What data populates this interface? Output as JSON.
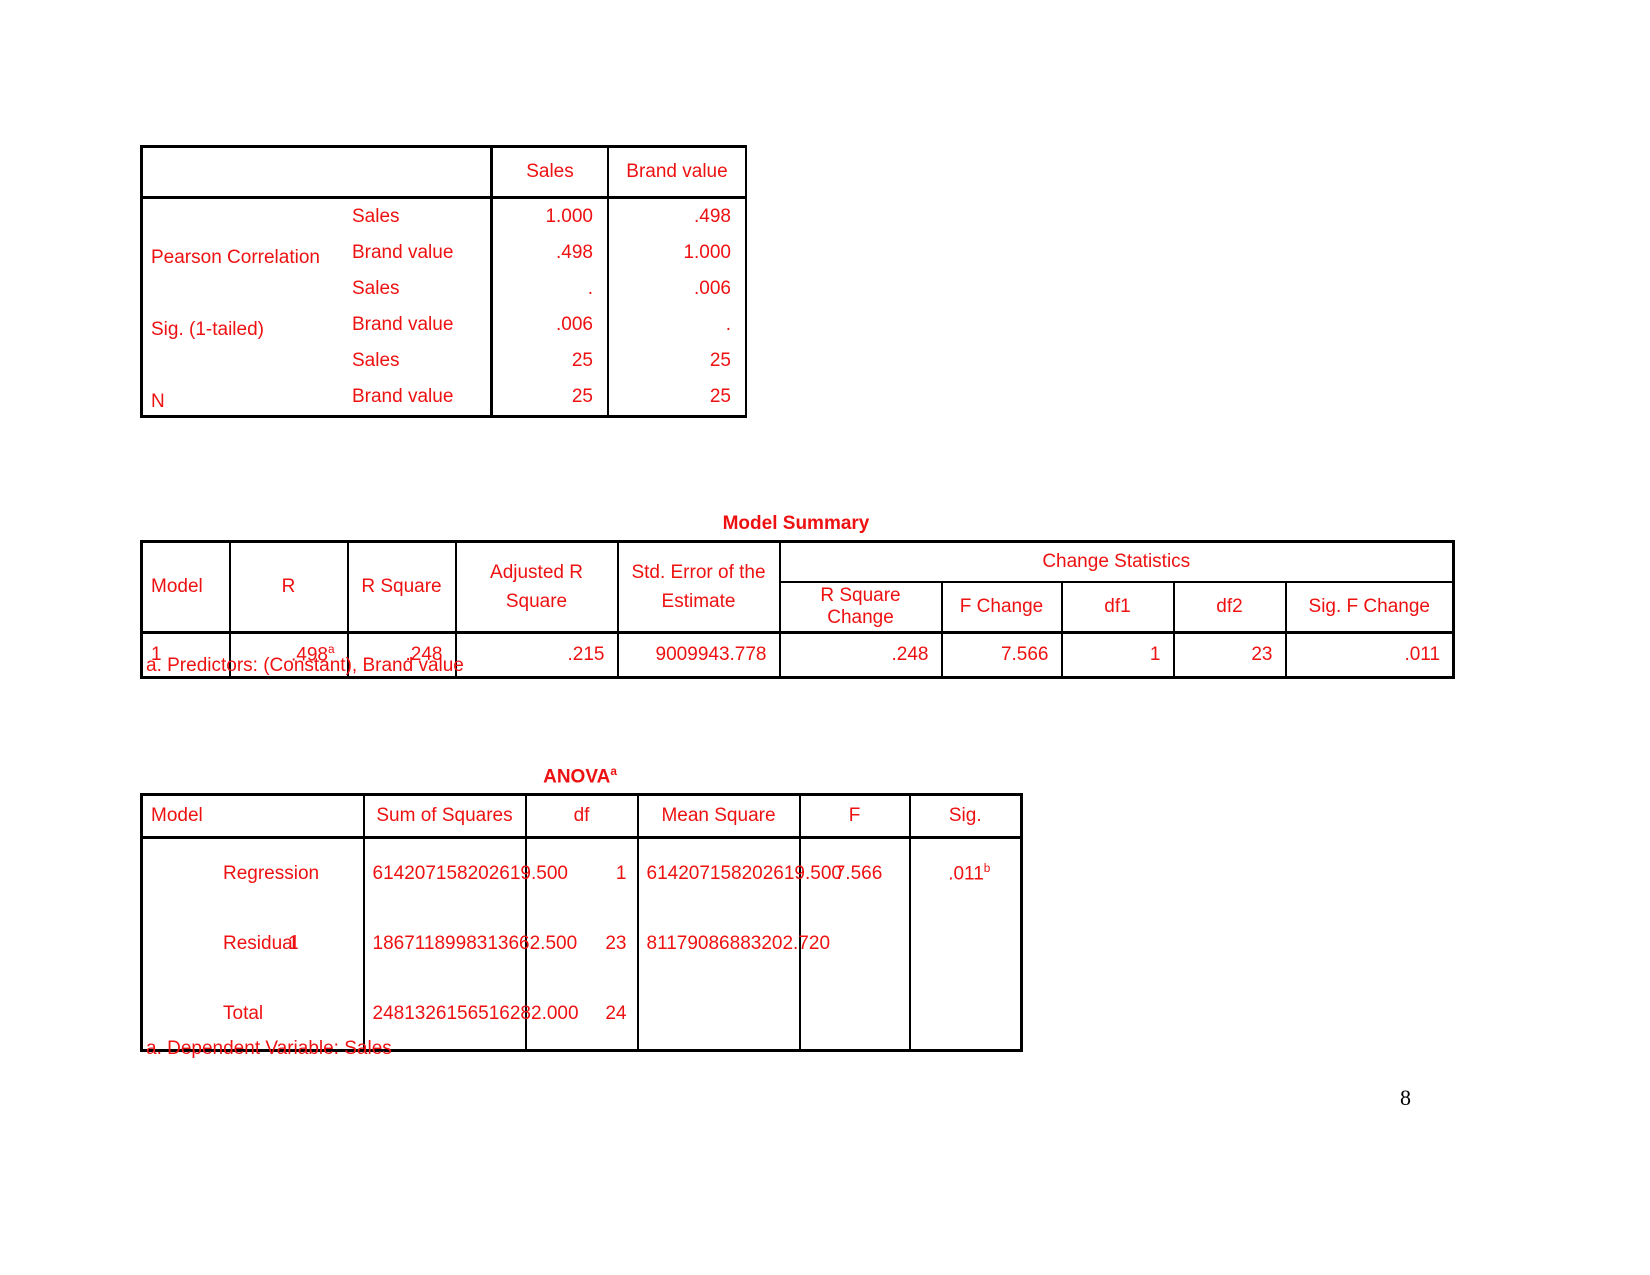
{
  "correlations": {
    "column_headers": [
      "",
      "",
      "Sales",
      "Brand value"
    ],
    "rows": [
      {
        "stat": "Pearson Correlation",
        "variable": "Sales",
        "sales": "1.000",
        "brand_value": ".498"
      },
      {
        "stat": "",
        "variable": "Brand value",
        "sales": ".498",
        "brand_value": "1.000"
      },
      {
        "stat": "Sig. (1-tailed)",
        "variable": "Sales",
        "sales": ".",
        "brand_value": ".006"
      },
      {
        "stat": "",
        "variable": "Brand value",
        "sales": ".006",
        "brand_value": "."
      },
      {
        "stat": "N",
        "variable": "Sales",
        "sales": "25",
        "brand_value": "25"
      },
      {
        "stat": "",
        "variable": "Brand value",
        "sales": "25",
        "brand_value": "25"
      }
    ]
  },
  "model_summary": {
    "title": "Model Summary",
    "headers": {
      "model": "Model",
      "r": "R",
      "r_square": "R Square",
      "adjusted_r_square": "Adjusted R Square",
      "std_error": "Std. Error of the Estimate",
      "change_statistics": "Change Statistics",
      "r_square_change": "R Square Change",
      "f_change": "F Change",
      "df1": "df1",
      "df2": "df2",
      "sig_f_change": "Sig. F Change"
    },
    "row": {
      "model": "1",
      "r": ".498",
      "r_superscript": "a",
      "r_square": ".248",
      "adjusted_r_square": ".215",
      "std_error": "9009943.778",
      "r_square_change": ".248",
      "f_change": "7.566",
      "df1": "1",
      "df2": "23",
      "sig_f_change": ".011"
    },
    "footnote": "a. Predictors: (Constant), Brand value"
  },
  "anova": {
    "title": "ANOVA",
    "title_superscript": "a",
    "headers": {
      "model": "Model",
      "sum_of_squares": "Sum of Squares",
      "df": "df",
      "mean_square": "Mean Square",
      "f": "F",
      "sig": "Sig."
    },
    "model_number": "1",
    "rows": [
      {
        "source": "Regression",
        "sum_of_squares": "614207158202619.500",
        "df": "1",
        "mean_square": "614207158202619.500",
        "f": "7.566",
        "sig": ".011",
        "sig_superscript": "b"
      },
      {
        "source": "Residual",
        "sum_of_squares": "1867118998313662.500",
        "df": "23",
        "mean_square": "81179086883202.720",
        "f": "",
        "sig": "",
        "sig_superscript": ""
      },
      {
        "source": "Total",
        "sum_of_squares": "2481326156516282.000",
        "df": "24",
        "mean_square": "",
        "f": "",
        "sig": "",
        "sig_superscript": ""
      }
    ],
    "footnote": "a. Dependent Variable: Sales"
  },
  "page_number": "8",
  "colors": {
    "text": "#ee1111",
    "border": "#000000",
    "background": "#ffffff"
  }
}
